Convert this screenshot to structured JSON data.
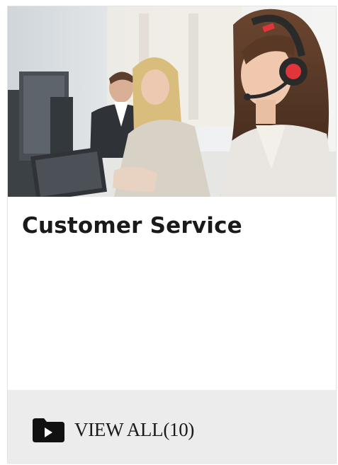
{
  "card": {
    "title": "Customer Service",
    "image_icon": "call-center-photo",
    "footer": {
      "icon": "video-folder-icon",
      "link_label": "VIEW ALL(10)"
    }
  },
  "colors": {
    "title_text": "#1a1a1a",
    "footer_bg": "#ececec",
    "headset_accent": "#e0353b"
  }
}
